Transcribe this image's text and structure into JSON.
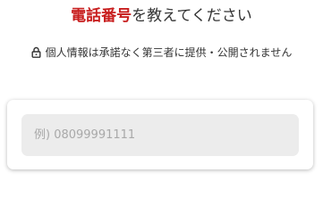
{
  "header": {
    "title_highlight": "電話番号",
    "title_rest": "を教えてください",
    "accent_color": "#c81e1e"
  },
  "privacy": {
    "icon": "lock-icon",
    "text": "個人情報は承諾なく第三者に提供・公開されません"
  },
  "phone": {
    "value": "",
    "placeholder": "例) 08099991111"
  }
}
